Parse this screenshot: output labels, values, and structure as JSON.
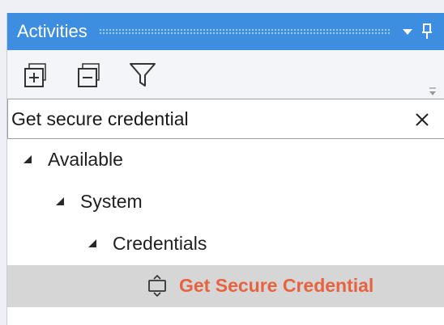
{
  "panel": {
    "title": "Activities"
  },
  "titlebar_buttons": [
    "dropdown-icon",
    "pin-icon"
  ],
  "toolbar": {
    "tools": [
      "expand-all-icon",
      "collapse-all-icon",
      "filter-icon"
    ]
  },
  "search": {
    "value": "Get secure credential",
    "placeholder": ""
  },
  "tree": {
    "nodes": [
      {
        "label": "Available",
        "level": 0,
        "expanded": true
      },
      {
        "label": "System",
        "level": 1,
        "expanded": true
      },
      {
        "label": "Credentials",
        "level": 2,
        "expanded": true
      },
      {
        "label": "Get Secure Credential",
        "level": 3,
        "icon": "activity-icon",
        "selected": true
      }
    ]
  },
  "colors": {
    "titlebar": "#3d8ee0",
    "highlight_text": "#e8623f",
    "selected_row": "#d6d6d6"
  }
}
